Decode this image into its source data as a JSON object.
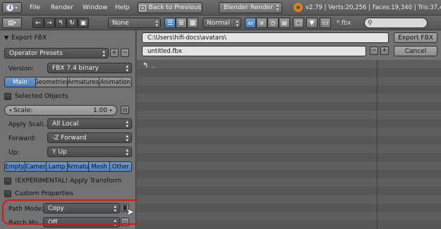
{
  "header": {
    "menus": [
      "File",
      "Render",
      "Window",
      "Help"
    ],
    "back_button": "Back to Previous",
    "render_engine": "Blender Render",
    "stats": "v2.79 | Verts:20,256 | Faces:19,340 | Tris:37,4"
  },
  "filebrowser_toolbar": {
    "display_mode": "None",
    "sort_mode": "Normal",
    "filter_ext": "*.fbx",
    "search_placeholder": ""
  },
  "panel": {
    "title": "Export FBX",
    "operator_presets": "Operator Presets",
    "version_label": "Version:",
    "version_value": "FBX 7.4 binary",
    "tabs": [
      "Main",
      "Geometries",
      "Armatures",
      "Animation"
    ],
    "selected_objects": "Selected Objects",
    "scale_label": "Scale:",
    "scale_value": "1.00",
    "apply_scalings_label": "Apply Scali...",
    "apply_scalings_value": "All Local",
    "forward_label": "Forward:",
    "forward_value": "-Z Forward",
    "up_label": "Up:",
    "up_value": "Y Up",
    "object_types": [
      "Empty",
      "Camer",
      "Lamp",
      "Armatu",
      "Mesh",
      "Other"
    ],
    "experimental_apply_transform": "!EXPERIMENTAL! Apply Transform",
    "custom_properties": "Custom Properties",
    "path_mode_label": "Path Mode:",
    "path_mode_value": "Copy",
    "batch_mode_label": "Batch Mo...",
    "batch_mode_value": "Off"
  },
  "file": {
    "directory": "C:\\Users\\hifi-docs\\avatars\\",
    "filename": "untitled.fbx",
    "export_button": "Export FBX",
    "cancel_button": "Cancel",
    "parent_entry": ".."
  },
  "colors": {
    "highlight_red": "#d8171b",
    "tab_blue": "#5a87c6"
  }
}
